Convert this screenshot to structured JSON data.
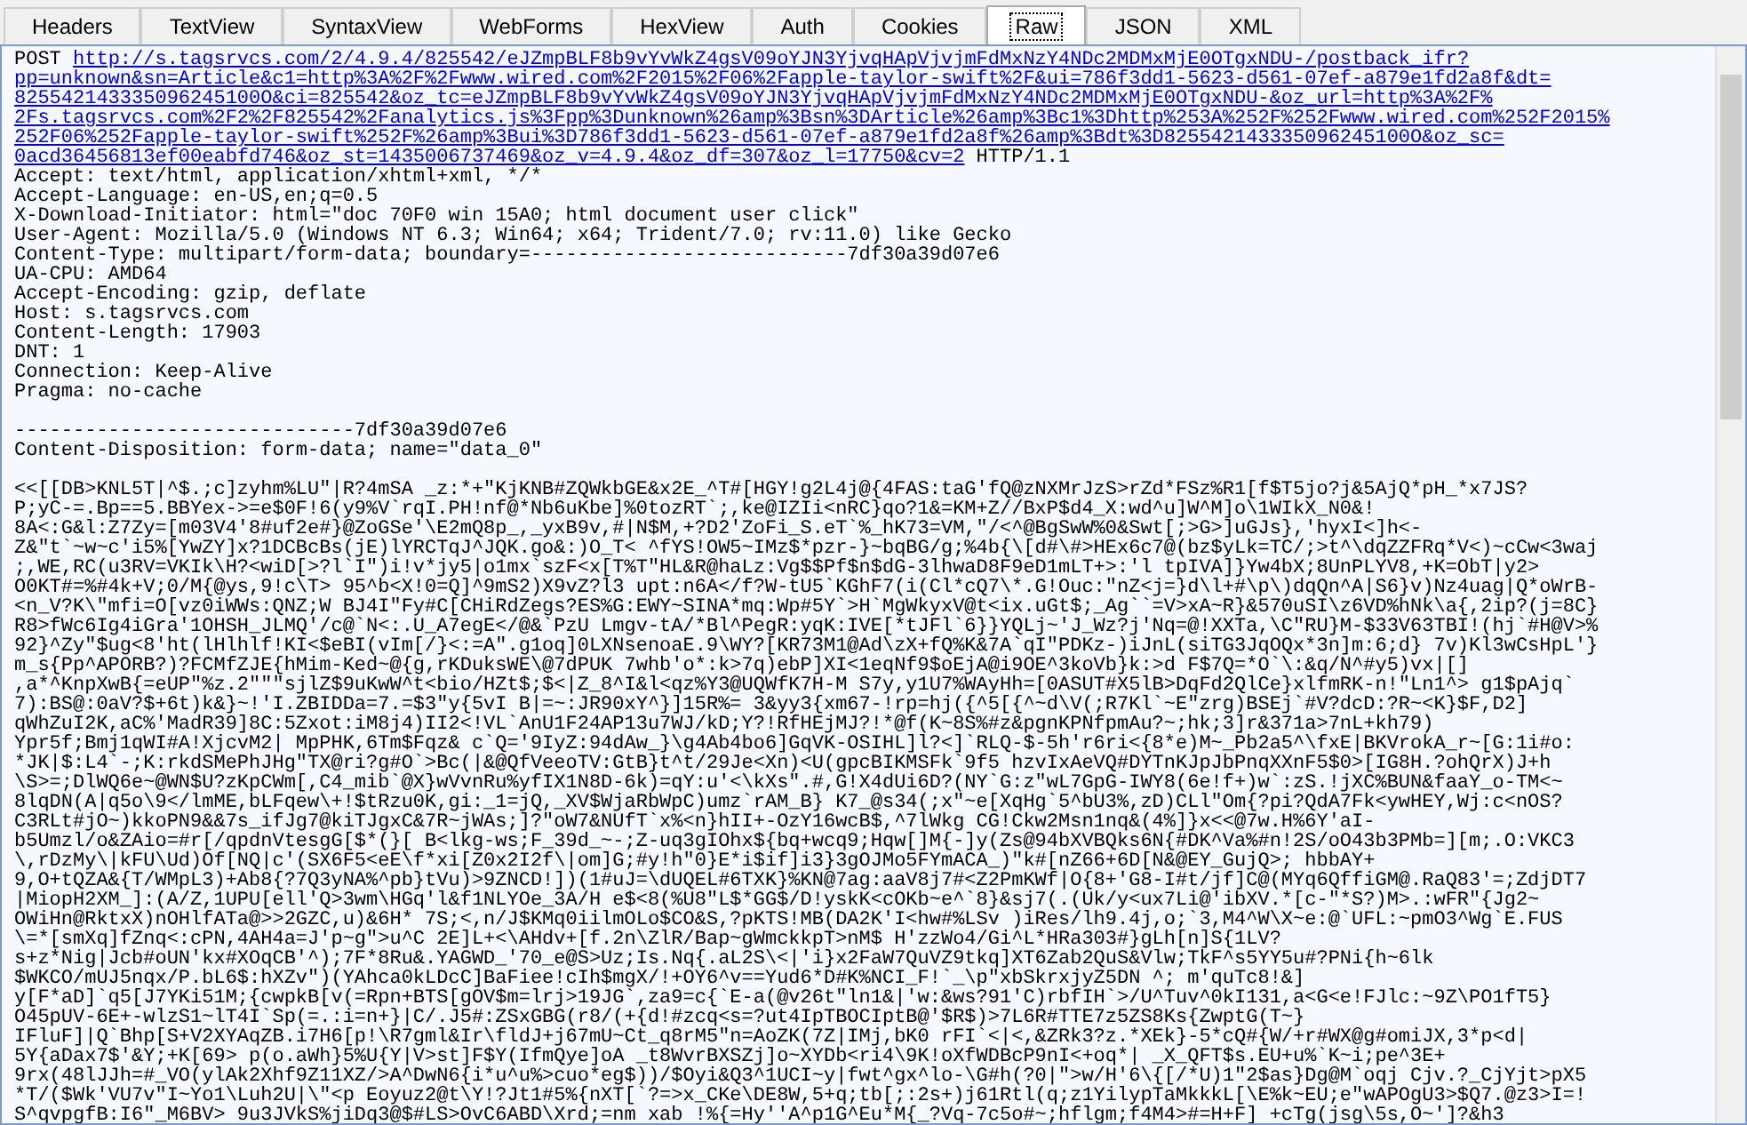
{
  "tabs": [
    {
      "label": "Headers",
      "selected": false
    },
    {
      "label": "TextView",
      "selected": false
    },
    {
      "label": "SyntaxView",
      "selected": false
    },
    {
      "label": "WebForms",
      "selected": false
    },
    {
      "label": "HexView",
      "selected": false
    },
    {
      "label": "Auth",
      "selected": false
    },
    {
      "label": "Cookies",
      "selected": false
    },
    {
      "label": "Raw",
      "selected": true
    },
    {
      "label": "JSON",
      "selected": false
    },
    {
      "label": "XML",
      "selected": false
    }
  ],
  "request": {
    "method": "POST",
    "url_lines": [
      "http://s.tagsrvcs.com/2/4.9.4/825542/eJZmpBLF8b9vYvWkZ4gsV09oYJN3YjvqHApVjvjmFdMxNzY4NDc2MDMxMjE0OTgxNDU-/postback_ifr?",
      "pp=unknown&sn=Article&c1=http%3A%2F%2Fwww.wired.com%2F2015%2F06%2Fapple-taylor-swift%2F&ui=786f3dd1-5623-d561-07ef-a879e1fd2a8f&dt=",
      "825542143335096245100O&ci=825542&oz_tc=eJZmpBLF8b9vYvWkZ4gsV09oYJN3YjvqHApVjvjmFdMxNzY4NDc2MDMxMjE0OTgxNDU-&oz_url=http%3A%2F%",
      "2Fs.tagsrvcs.com%2F2%2F825542%2Fanalytics.js%3Fpp%3Dunknown%26amp%3Bsn%3DArticle%26amp%3Bc1%3Dhttp%253A%252F%252Fwww.wired.com%252F2015%",
      "252F06%252Fapple-taylor-swift%252F%26amp%3Bui%3D786f3dd1-5623-d561-07ef-a879e1fd2a8f%26amp%3Bdt%3D825542143335096245100O&oz_sc=",
      "0acd36456813ef00eabfd746&oz_st=1435006737469&oz_v=4.9.4&oz_df=307&oz_l=17750&cv=2"
    ],
    "version": "HTTP/1.1"
  },
  "headers": [
    "Accept: text/html, application/xhtml+xml, */*",
    "Accept-Language: en-US,en;q=0.5",
    "X-Download-Initiator: html=\"doc 70F0 win 15A0; html document user click\"",
    "User-Agent: Mozilla/5.0 (Windows NT 6.3; Win64; x64; Trident/7.0; rv:11.0) like Gecko",
    "Content-Type: multipart/form-data; boundary=---------------------------7df30a39d07e6",
    "UA-CPU: AMD64",
    "Accept-Encoding: gzip, deflate",
    "Host: s.tagsrvcs.com",
    "Content-Length: 17903",
    "DNT: 1",
    "Connection: Keep-Alive",
    "Pragma: no-cache"
  ],
  "part": {
    "boundary": "-----------------------------7df30a39d07e6",
    "disposition": "Content-Disposition: form-data; name=\"data_0\""
  },
  "body_lines": [
    "<<[[DB>KNL5T|^$.;c]zyhm%LU\"|R?4mSA _z:*+\"KjKNB#ZQWkbGE&x2E_^T#[HGY!g2L4j@{4FAS:taG'fQ@zNXMrJzS>rZd*FSz%R1[f$T5jo?j&5AjQ*pH_*x7JS?",
    "P;yC-=.Bp==5.BBYex->=e$0F!6(y9%V`rqI.PH!nf@*Nb6uKbe]%0tozRT`;,ke@IZIi<nRC}qo?1&=KM+Z//BxP$d4_X:wd^u]W^M]o\\1WIkX_N0&!",
    "8A<:G&l:Z7Zy=[m03V4'8#uf2e#}@ZoGSe'\\E2mQ8p_,_yxB9v,#|N$M,+?D2'ZoFi_S.eT`%_hK73=VM,\"/<^@BgSwW%0&Swt[;>G>]uGJs},'hyxI<]h<-",
    "Z&\"t`~w~c'i5%[YwZY]x?1DCBcBs(jE)lYRCTqJ^JQK.go&:)O_T< ^fYS!OW5~IMz$*pzr-}~bqBG/g;%4b{\\[d#\\#>HEx6c7@(bz$yLk=TC/;>t^\\dqZZFRq*V<)~cCw<3waj",
    ";,WE,RC(u3RV=VKIk\\H?<wiD[>?l`I\")i!v*jy5|o1mx`szF<x[T%T\"HL&R@haLz:Vg$$Pf$n$dG-3lhwaD8F9eD1mLT+>:'l tpIVA]}Yw4bX;8UnPLYV8,+K=ObT|y2>",
    "O0KT#=%#4k+V;0/M{@ys,9!c\\T> 95^b<X!0=Q]^9mS2)X9vZ?l3 upt:n6A</f?W-tU5`KGhF7(i(Cl*cQ7\\*.G!Ouc:\"nZ<j=}d\\l+#\\p\\)dqQn^A|S6}v)Nz4uag|Q*oWrB-",
    "<n_V?K\\\"mfi=O[vz0iWWs:QNZ;W BJ4I\"Fy#C[CHiRdZegs?ES%G:EWY~SINA*mq:Wp#5Y`>H`MgWkyxV@t<ix.uGt$;_Ag``=V>xA~R}&570uSI\\z6VD%hNk\\a{,2ip?(j=8C}",
    "R8>fWc6Ig4iGra'1OHSH_JLMQ'/c@`N<:.U_A7egE</@&`PzU Lmgv-tA/*Bl^PegR:yqK:IVE[*tJFl`6}}YQLj~'J_Wz?j'Nq=@!XXTa,\\C\"RU}M-$33V63TBI!(hj`#H@V>%",
    "92}^Zy\"$ug<8'ht(lHlhlf!KI<$eBI(vIm[/}<:=A\".g1oq]0LXNsenoaE.9\\WY?[KR73M1@Ad\\zX+fQ%K&7A`qI\"PDKz-)iJnL(siTG3JqOQx*3n]m:6;d} 7v)Kl3wCsHpL'}",
    "m_s{Pp^APORB?)?FCMfZJE{hMim-Ked~@{g,rKDuksWE\\@7dPUK 7whb'o*:k>7q)ebP]XI<1eqNf9$oEjA@i9OE^3koVb}k:>d F$7Q=*O`\\:&q/N^#y5)vx|[]",
    ",a*^KnpXwB{=eUP\"%z.2\"\"\"sjlZ$9uKwW^t<bio/HZt$;$<|Z_8^I&l<qz%Y3@UQWfK7H-M S7y,y1U7%WAyHh=[0ASUT#X5lB>DqFd2QlCe}xlfmRK-n!\"Ln1^> g1$pAjq`",
    "7):BS@:0aV?$+6t)k&}~!'I.ZBIDDa=7.=$3\"y{5vI B|=~:JR90xY^}]15R%= 3&yy3{xm67-!rp=hj({^5[{^~d\\V(;R7Kl`~E\"zrg)BSEj`#V?dcD:?R~<K}$F,D2]",
    "qWhZuI2K,aC%'MadR39]8C:5Zxot:iM8j4)II2<!VL`AnU1F24AP13u7WJ/kD;Y?!RfHEjMJ?!*@f(K~8S%#z&pgnKPNfpmAu?~;hk;3]r&371a>7nL+kh79)",
    "Ypr5f;Bmj1qWI#A!XjcvM2| MpPHK,6Tm$Fqz& c`Q='9IyZ:94dAw_}\\g4Ab4bo6]GqVK-OSIHL]l?<]`RLQ-$-5h'r6ri<{8*e)M~_Pb2a5^\\fxE|BKVrokA_r~[G:1i#o:",
    "*JK|$:L4`-;K:rkdSMePhJHg\"TX@ri?g#O`>Bc(|&@QfVeeoTV:GtB}t^t/29Je<Xn)<U(gpcBIKMSFk`9f5 hzvIxAeVQ#DYTnKJpJbPnqXXnF5$0>[IG8H.?ohQrX)J+h",
    "\\S>=;DlWQ6e~@WN$U?zKpCWm[,C4_mib`@X}wVvnRu%yfIX1N8D-6k)=qY:u'<\\kXs\".#,G!X4dUi6D?(NY`G:z\"wL7GpG-IWY8(6e!f+)w`:zS.!jXC%BUN&faaY_o-TM<~",
    "8lqDN(A|q5o\\9</lmME,bLFqew\\+!$tRzu0K,gi:_1=jQ,_XV$WjaRbWpC)umz`rAM_B} K7_@s34(;x\"~e[XqHg`5^bU3%,zD)CLl\"Om{?pi?QdA7Fk<ywHEY,Wj:c<nOS?",
    "C3RLt#jO~)kkoPN9&&7s_ifJg7@kiTJgxC&7R~jWAs;]?\"oW7&NUfT`x%<n}hII+-OzY16wcB$,^7lWkg CG!Ckw2Msn1nq&(4%]}x<<@7w.H%6Y'aI-",
    "b5Umzl/o&ZAio=#r[/qpdnVtesgG[$*(}[ B<lkg-ws;F_39d_~-;Z-uq3gIOhx${bq+wcq9;Hqw[]M{-]y(Zs@94bXVBQks6N{#DK^Va%#n!2S/oO43b3PMb=][m;.O:VKC3",
    "\\,rDzMy\\|kFU\\Ud)Of[NQ|c'(SX6F5<eE\\f*xi[Z0x2I2f\\|om]G;#y!h\"0}E*i$if]i3}3gOJMo5FYmACA_)\"k#[nZ66+6D[N&@EY_GujQ>; hbbAY+",
    "9,O+tQZA&{T/WMpL3)+Ab8{?7Q3yNA%^pb}tVu)>9ZNCD!])(1#uJ=\\dUQEL#6TXK}%KN@7ag:aaV8j7#<Z2PmKWf|O{8+'G8-I#t/jf]C@(MYq6QffiGM@.RaQ83'=;ZdjDT7",
    "|MiopH2XM_]:(A/Z,1UPU[ell'Q>3wm\\HGq'l&f1NLYOe_3A/H e$<8(%U8\"L$*GG$/D!yskK<cOKb~e^`8}&sj7(.(Uk/y<ux7Li@'ibXV.*[c-\"*S?)M>.:wFR\"{Jg2~",
    "OWiHn@RktxX)nOHlfATa@>>2GZC,u)&6H* 7S;<,n/J$KMq0iilmOLo$CO&S,?pKTS!MB(DA2K'I<hw#%LSv )iRes/lh9.4j,o;`3,M4^W\\X~e:@`UFL:~pmO3^Wg`E.FUS",
    "\\=*[smXq]fZnq<:cPN,4AH4a=J'p~g\">u^C 2E]L+<\\AHdv+[f.2n\\ZlR/Bap~gWmckkpT>nM$ H'zzWo4/Gi^L*HRa303#}gLh[n]S{1LV?",
    "s+z*Nig|Jcb#oUN'kx#XOqCB'^);7F*8Ru&.YAGWD_'70_e@S>Uz;Is.Nq{.aL2S\\<|'i}x2FaW7QuVZ9tkq]XT6Zab2QuS&Vlw;TkF^s5YY5u#?PNi{h~6lk",
    "$WKCO/mUJ5nqx/P.bL6$:hXZv\")(YAhca0kLDcC]BaFiee!cIh$mgX/!+OY6^v==Yud6*D#K%NCI_F!`_\\p\"xbSkrxjyZ5DN ^; m'quTc8!&]",
    "y[F*aD]`q5[J7YKi51M;{cwpkB[v(=Rpn+BTS[gOV$m=lrj>19JG`,za9=c{`E-a(@v26t\"ln1&|'w:&ws?91'C)rbfIH`>/U^Tuv^0kI131,a<G<e!FJlc:~9Z\\PO1fT5}",
    "O45pUV-6E+-wlzS1~lT4I`Sp(=.:i=n+}|C/.J5#:ZSxGBG(r8/(+{d!#zcq<s=?ut4IpTBOCIptB@'$R$)>7L6R#TTE7z5ZS8Ks{ZwptG(T~}",
    "IFluF]|Q`Bhp[S+V2XYAqZB.i7H6[p!\\R7gml&Ir\\fldJ+j67mU~Ct_q8rM5\"n=AoZK(7Z|IMj,bK0 rFI`<|<,&ZRk3?z.*XEk}-5*cQ#{W/+r#WX@g#omiJX,3*p<d|",
    "5Y{aDax7$'&Y;+K[69> p(o.aWh}5%U{Y|V>st]F$Y(IfmQye]oA _t8WvrBXSZj]o~XYDb<ri4\\9K!oXfWDBcP9nI<+oq*| _X_QFT$s.EU+u%`K~i;pe^3E+",
    "9rx(48lJJh=#_VO(ylAk2Xhf9Z11XZ/>A^DwN6{i*u^u%>cuo*eg$))/$Oyi&Q3^1UCI~y|fwt^gx^lo-\\G#h(?0|\">w/H'6\\{[/*U)1\"2$as}Dg@M`oqj Cjv.?_CjYjt>pX5",
    "*T/($Wk'VU7v\"I~Yo1\\Luh2U|\\\"<p Eoyuz2@t\\Y!?Jt1#5%{nXT[`?=>x_CKe\\DE8W,5+q;tb[;:2s+)j61Rtl(q;z1YilypTaMkkkL[\\E%k~EU;e\"wAPOgU3>$Q7.@z3>I=!",
    "S^qvpgfB:I6\"_M6BV> 9u3JVkS%jiDq3@$#LS>OvC6ABD\\Xrd;=nm xab !%{=Hy''A^p1G^Eu*M{_?Vq-7c5o#~;hflgm;f4M4>#=H+F] +cTg(jsg\\5s,O~']?&h3"
  ]
}
